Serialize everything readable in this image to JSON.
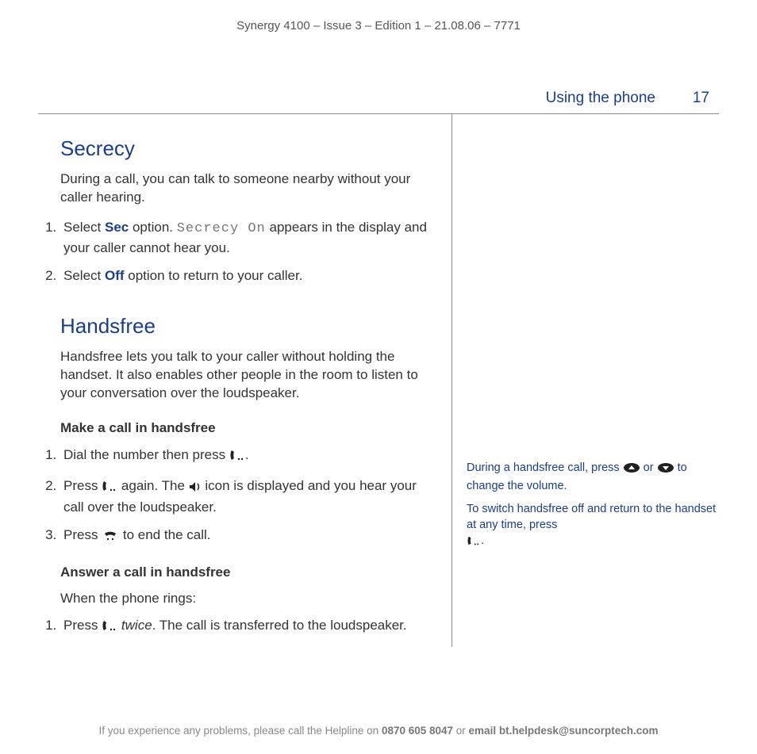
{
  "header": "Synergy 4100 – Issue 3 – Edition 1 – 21.08.06 – 7771",
  "section": "Using the phone",
  "page_number": "17",
  "secrecy": {
    "title": "Secrecy",
    "intro": "During a call, you can talk to someone nearby without your caller hearing.",
    "step1_a": "Select ",
    "step1_opt": "Sec",
    "step1_b": " option. ",
    "step1_lcd": "Secrecy On",
    "step1_c": " appears in the display and your caller cannot hear you.",
    "step2_a": "Select ",
    "step2_opt": "Off",
    "step2_b": " option to return to your caller."
  },
  "handsfree": {
    "title": "Handsfree",
    "intro": "Handsfree lets you talk to your caller without holding the handset. It also enables other people in the room to listen to your conversation over the loudspeaker.",
    "make_head": "Make a call in handsfree",
    "m1_a": "Dial the number then press ",
    "m1_b": ".",
    "m2_a": "Press ",
    "m2_b": " again. The ",
    "m2_c": " icon is displayed and you hear your call over the loudspeaker.",
    "m3_a": "Press ",
    "m3_b": " to end the call.",
    "ans_head": "Answer a call in handsfree",
    "ans_intro": "When the phone rings:",
    "a1_a": "Press ",
    "a1_b": " ",
    "a1_i": "twice",
    "a1_c": ". The call is transferred to the loudspeaker."
  },
  "side": {
    "l1_a": "During a handsfree call, press ",
    "l1_b": " or ",
    "l1_c": " to change the volume.",
    "l2_a": "To switch handsfree off and return to the handset at any time, press ",
    "l2_b": "."
  },
  "footer": {
    "a": "If you experience any problems, please call the Helpline on ",
    "phone": "0870 605 8047",
    "b": " or ",
    "email_pre": "email ",
    "email": "bt.helpdesk@suncorptech.com"
  }
}
